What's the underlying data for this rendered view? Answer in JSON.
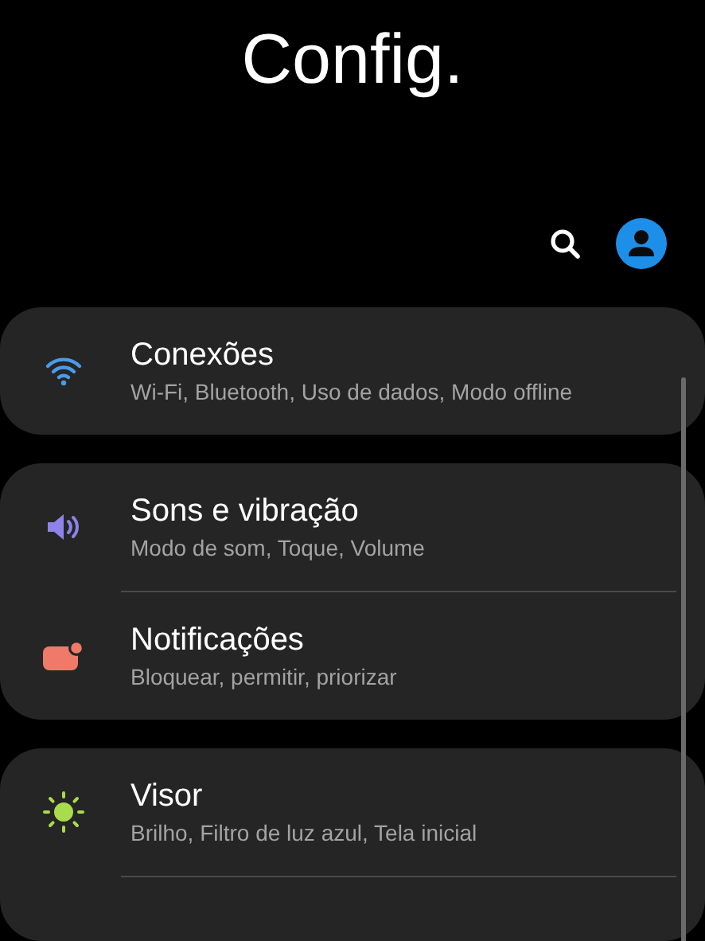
{
  "title": "Config.",
  "groups": [
    {
      "items": [
        {
          "kind": "wifi",
          "color": "#4a9be8",
          "title": "Conexões",
          "subtitle": "Wi-Fi, Bluetooth, Uso de dados, Modo offline"
        }
      ]
    },
    {
      "items": [
        {
          "kind": "sound",
          "color": "#8f82e8",
          "title": "Sons e vibração",
          "subtitle": "Modo de som, Toque, Volume"
        },
        {
          "kind": "notification",
          "color": "#f07a6a",
          "title": "Notificações",
          "subtitle": "Bloquear, permitir, priorizar"
        }
      ]
    },
    {
      "items": [
        {
          "kind": "display",
          "color": "#a9dc4c",
          "title": "Visor",
          "subtitle": "Brilho, Filtro de luz azul, Tela inicial"
        }
      ],
      "more_below": true
    }
  ]
}
